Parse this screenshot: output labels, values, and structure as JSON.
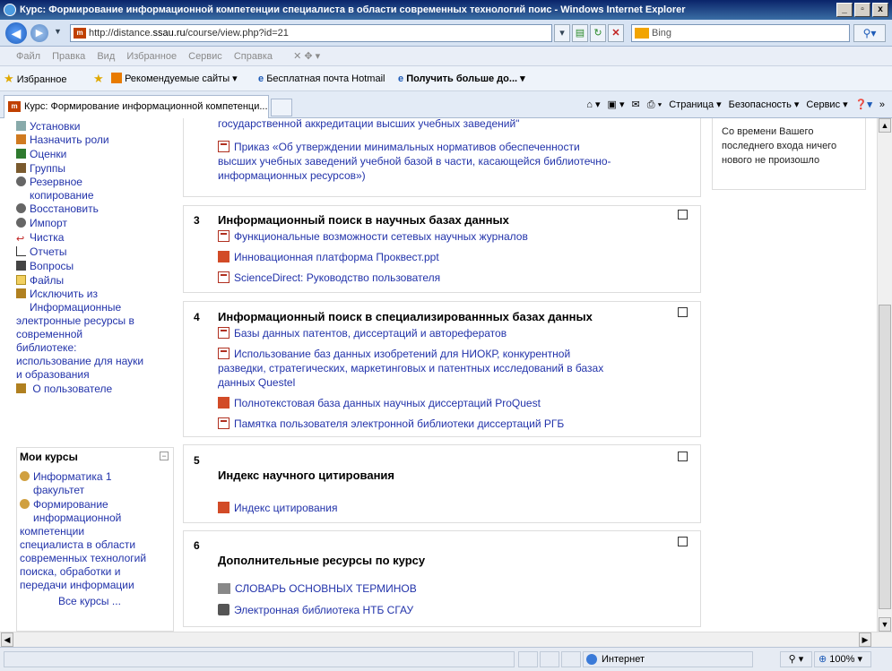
{
  "window": {
    "title": "Курс: Формирование информационной компетенции специалиста в области современных технологий поис - Windows Internet Explorer",
    "minimize": "_",
    "maximize": "▫",
    "close": "x"
  },
  "address": {
    "url_prefix": "http://distance.",
    "url_domain": "ssau.ru",
    "url_suffix": "/course/view.php?id=21",
    "search_placeholder": "Bing"
  },
  "menu": [
    "Файл",
    "Правка",
    "Вид",
    "Избранное",
    "Сервис",
    "Справка"
  ],
  "favorites": {
    "label": "Избранное",
    "suggested": "Рекомендуемые сайты ▾",
    "hotmail": "Бесплатная почта Hotmail",
    "more": "Получить больше до..."
  },
  "tab": {
    "title": "Курс: Формирование информационной компетенци..."
  },
  "command_bar": [
    "Страница ▾",
    "Безопасность ▾",
    "Сервис ▾"
  ],
  "admin_menu": [
    "Установки",
    "Назначить роли",
    "Оценки",
    "Группы",
    "Резервное",
    "копирование",
    "Восстановить",
    "Импорт",
    "Чистка",
    "Отчеты",
    "Вопросы",
    "Файлы",
    "Исключить из",
    "Информационные",
    "электронные ресурсы в",
    "современной",
    "библиотеке:",
    "использование для науки",
    "и образования",
    "О пользователе"
  ],
  "my_courses": {
    "header": "Мои курсы",
    "lines": [
      "Информатика 1",
      "факультет",
      "Формирование",
      "информационной",
      "компетенции",
      "специалиста в области",
      "современных технологий",
      "поиска, обработки и",
      "передачи информации"
    ],
    "all": "Все курсы ..."
  },
  "recent": {
    "text1": "Со времени Вашего",
    "text2": "последнего входа ничего",
    "text3": "нового не произошло"
  },
  "section2": {
    "partial_line": "государственной аккредитации высших учебных заведений\"",
    "res_lines": [
      "Приказ «Об утверждении минимальных нормативов обеспеченности",
      "высших учебных заведений учебной базой в части, касающейся библиотечно-",
      "информационных ресурсов»)"
    ]
  },
  "section3": {
    "num": "3",
    "title": "Информационный поиск в научных базах данных",
    "resources": [
      "Функциональные возможности сетевых научных журналов",
      "Инновационная платформа Проквест.ppt",
      "ScienceDirect: Руководство пользователя"
    ]
  },
  "section4": {
    "num": "4",
    "title": "Информационный поиск в специализированнных базах данных",
    "r1": "Базы данных патентов, диссертаций и авторефератов",
    "r2a": "Использование баз данных изобретений для НИОКР, конкурентной",
    "r2b": "разведки, стратегических, маркетинговых и патентных исследований в базах",
    "r2c": "данных Questel",
    "r3": "Полнотекстовая база данных научных диссертаций ProQuest",
    "r4": "Памятка пользователя электронной библиотеки диссертаций РГБ"
  },
  "section5": {
    "num": "5",
    "title": "Индекс научного цитирования",
    "r1": "Индекс цитирования"
  },
  "section6": {
    "num": "6",
    "title": "Дополнительные ресурсы по курсу",
    "r1": "СЛОВАРЬ ОСНОВНЫХ ТЕРМИНОВ",
    "r2": "Электронная библиотека НТБ СГАУ"
  },
  "statusbar": {
    "zone": "Интернет",
    "zoom": "100%"
  }
}
